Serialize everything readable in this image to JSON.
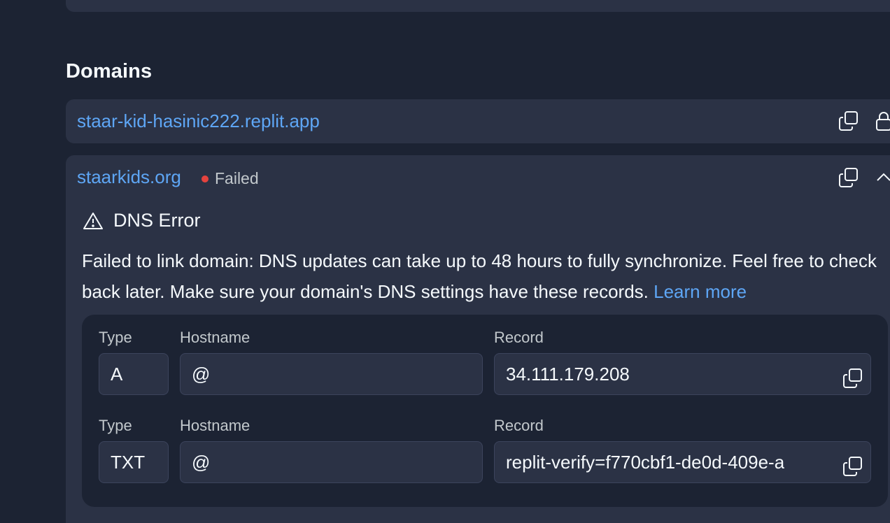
{
  "section": {
    "title": "Domains"
  },
  "domains": [
    {
      "name": "staar-kid-hasinic222.replit.app"
    },
    {
      "name": "staarkids.org",
      "status": "Failed",
      "status_color": "#e5433e",
      "error": {
        "title": "DNS Error",
        "message": "Failed to link domain: DNS updates can take up to 48 hours to fully synchronize. Feel free to check back later. Make sure your domain's DNS settings have these records.",
        "learn_more": "Learn more"
      },
      "records": [
        {
          "type_label": "Type",
          "hostname_label": "Hostname",
          "record_label": "Record",
          "type": "A",
          "hostname": "@",
          "record": "34.111.179.208"
        },
        {
          "type_label": "Type",
          "hostname_label": "Hostname",
          "record_label": "Record",
          "type": "TXT",
          "hostname": "@",
          "record": "replit-verify=f770cbf1-de0d-409e-a"
        }
      ]
    }
  ],
  "colors": {
    "background": "#1c2333",
    "card": "#2b3245",
    "link": "#5ea6f5",
    "text": "#f5f9fc",
    "muted": "#c2c8cc"
  },
  "icons": [
    "copy-icon",
    "lock-icon",
    "chevron-up-icon",
    "warning-icon"
  ]
}
